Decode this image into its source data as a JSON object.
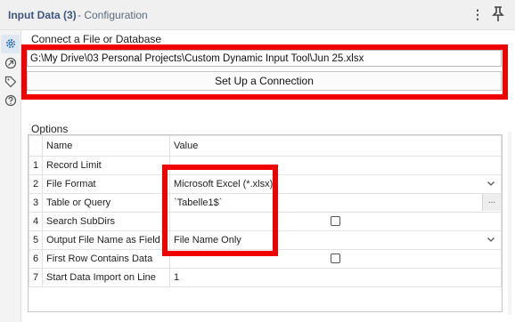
{
  "window": {
    "title": "Input Data (3)",
    "subtitle": "- Configuration"
  },
  "icons": {
    "kebab": "more-vertical-icon",
    "pin": "pin-icon",
    "sidebar": [
      "gear-icon",
      "connection-icon",
      "tag-icon",
      "help-icon"
    ]
  },
  "connect_section": {
    "label": "Connect a File or Database",
    "file_path": "G:\\My Drive\\03 Personal Projects\\Custom Dynamic Input Tool\\Jun 25.xlsx",
    "setup_button": "Set Up a Connection"
  },
  "options_section": {
    "label": "Options",
    "columns": [
      "Name",
      "Value"
    ],
    "rows": [
      {
        "num": "1",
        "name": "Record Limit",
        "value": ""
      },
      {
        "num": "2",
        "name": "File Format",
        "value": "Microsoft Excel (*.xlsx)"
      },
      {
        "num": "3",
        "name": "Table or Query",
        "value": "`Tabelle1$`",
        "button": "..."
      },
      {
        "num": "4",
        "name": "Search SubDirs",
        "value": ""
      },
      {
        "num": "5",
        "name": "Output File Name as Field",
        "value": "File Name Only"
      },
      {
        "num": "6",
        "name": "First Row Contains Data",
        "value": ""
      },
      {
        "num": "7",
        "name": "Start Data Import on Line",
        "value": "1"
      }
    ]
  },
  "colors": {
    "highlight": "#f10000",
    "title_text": "#3f5680",
    "active_icon": "#2f6fc3"
  }
}
